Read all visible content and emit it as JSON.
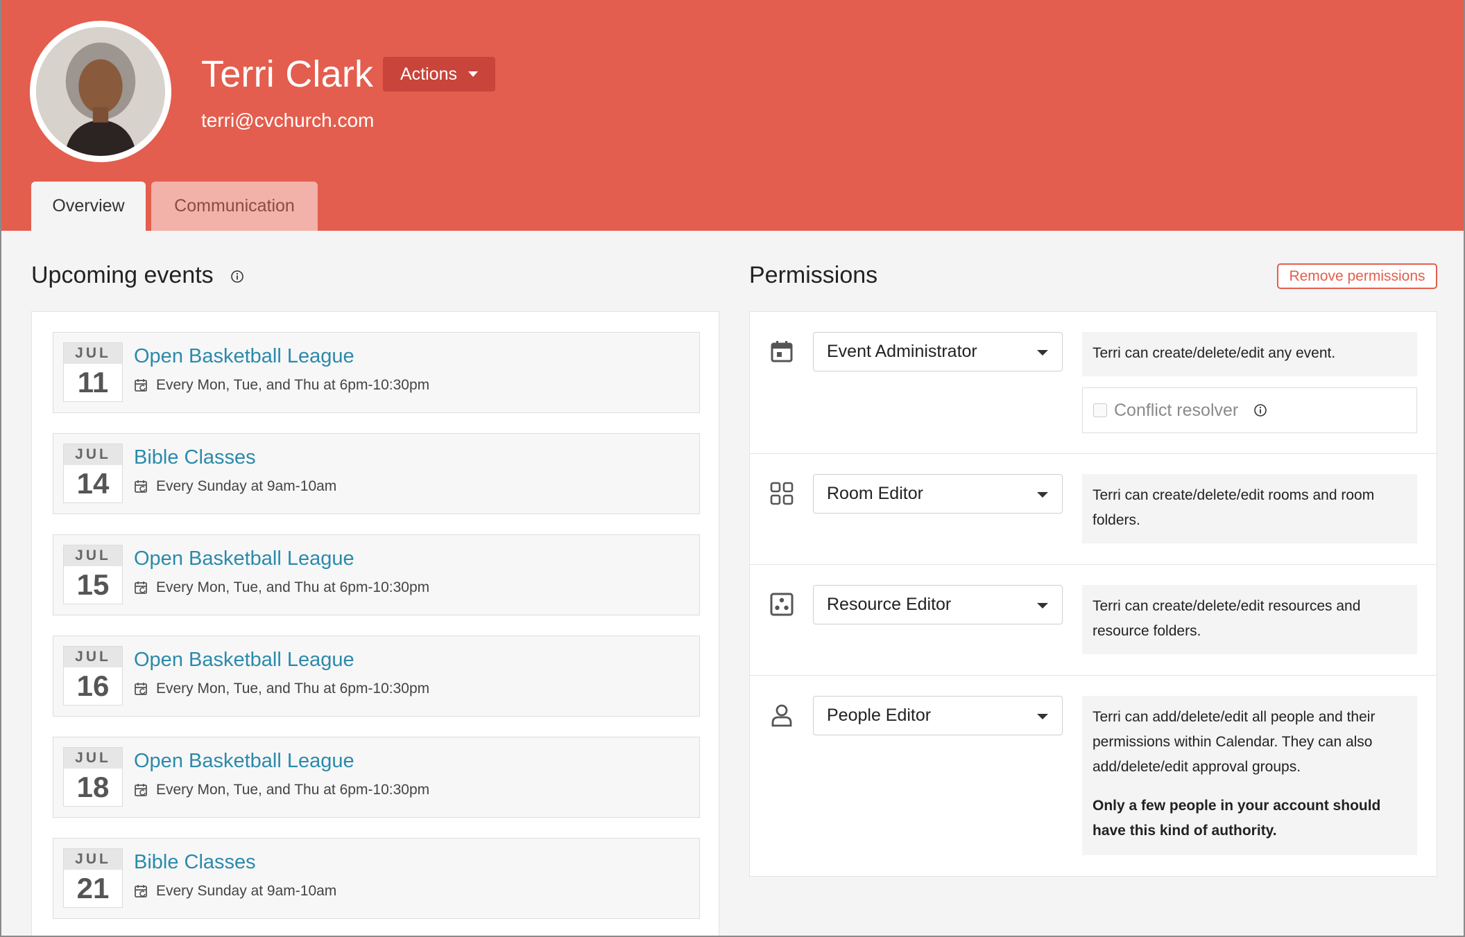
{
  "profile": {
    "name": "Terri Clark",
    "email": "terri@cvchurch.com",
    "actions_label": "Actions"
  },
  "tabs": [
    {
      "label": "Overview",
      "active": true
    },
    {
      "label": "Communication",
      "active": false
    }
  ],
  "upcoming": {
    "title": "Upcoming events",
    "events": [
      {
        "month": "JUL",
        "day": "11",
        "title": "Open Basketball League",
        "schedule": "Every Mon, Tue, and Thu at 6pm-10:30pm"
      },
      {
        "month": "JUL",
        "day": "14",
        "title": "Bible Classes",
        "schedule": "Every Sunday at 9am-10am"
      },
      {
        "month": "JUL",
        "day": "15",
        "title": "Open Basketball League",
        "schedule": "Every Mon, Tue, and Thu at 6pm-10:30pm"
      },
      {
        "month": "JUL",
        "day": "16",
        "title": "Open Basketball League",
        "schedule": "Every Mon, Tue, and Thu at 6pm-10:30pm"
      },
      {
        "month": "JUL",
        "day": "18",
        "title": "Open Basketball League",
        "schedule": "Every Mon, Tue, and Thu at 6pm-10:30pm"
      },
      {
        "month": "JUL",
        "day": "21",
        "title": "Bible Classes",
        "schedule": "Every Sunday at 9am-10am"
      }
    ]
  },
  "permissions": {
    "title": "Permissions",
    "remove_label": "Remove permissions",
    "rows": [
      {
        "icon": "calendar-icon",
        "role": "Event Administrator",
        "description": "Terri can create/delete/edit any event.",
        "conflict_resolver_label": "Conflict resolver"
      },
      {
        "icon": "grid-icon",
        "role": "Room Editor",
        "description": "Terri can create/delete/edit rooms and room folders."
      },
      {
        "icon": "resource-icon",
        "role": "Resource Editor",
        "description": "Terri can create/delete/edit resources and resource folders."
      },
      {
        "icon": "person-icon",
        "role": "People Editor",
        "description": "Terri can add/delete/edit all people and their permissions within Calendar. They can also add/delete/edit approval groups.",
        "warning": "Only a few people in your account should have this kind of authority."
      }
    ]
  },
  "colors": {
    "header": "#e35e4e",
    "actions": "#c9443a",
    "link": "#2b8aab"
  }
}
